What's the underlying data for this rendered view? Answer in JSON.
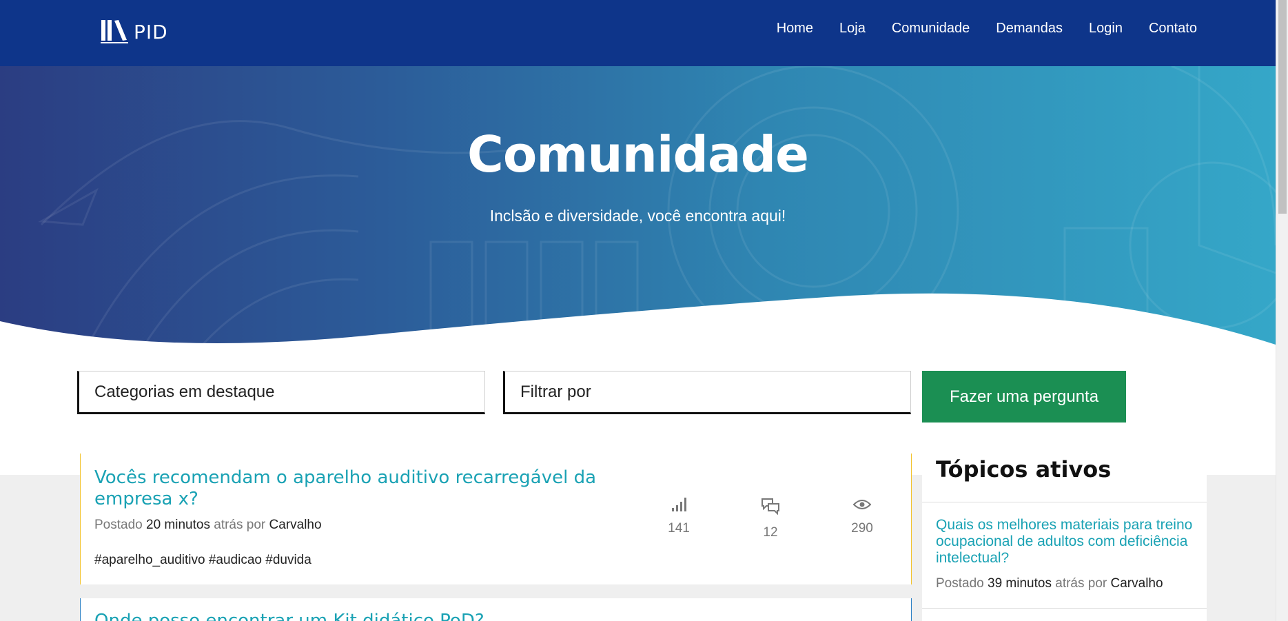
{
  "header": {
    "logo_text": "PID",
    "nav": [
      "Home",
      "Loja",
      "Comunidade",
      "Demandas",
      "Login",
      "Contato"
    ]
  },
  "hero": {
    "title": "Comunidade",
    "subtitle": "Inclsão e diversidade, você encontra aqui!"
  },
  "controls": {
    "categories_label": "Categorias em destaque",
    "filter_label": "Filtrar por",
    "ask_button": "Fazer uma pergunta"
  },
  "posts": [
    {
      "title": "Vocês recomendam o aparelho auditivo recarregável da empresa x?",
      "meta_prefix": "Postado",
      "time": "20 minutos",
      "meta_mid": "atrás por",
      "author": "Carvalho",
      "tags": "#aparelho_auditivo #audicao #duvida",
      "stats": {
        "score": "141",
        "replies": "12",
        "views": "290"
      },
      "accent_color": "#f2c22a"
    },
    {
      "title": "Onde posso encontrar um Kit didático PoD?",
      "accent_color": "#2a7fc4"
    }
  ],
  "sidebar": {
    "heading": "Tópicos ativos",
    "topic": {
      "title": "Quais os melhores materiais para treino ocupacional de adultos com deficiência intelectual?",
      "meta_prefix": "Postado",
      "time": "39 minutos",
      "meta_mid": "atrás por",
      "author": "Carvalho"
    }
  },
  "colors": {
    "header_bg": "#0e358a",
    "accent_teal": "#1aa2b4",
    "button_green": "#1b8f53"
  },
  "icons": [
    "signal-bars-icon",
    "chat-bubbles-icon",
    "eye-icon"
  ]
}
